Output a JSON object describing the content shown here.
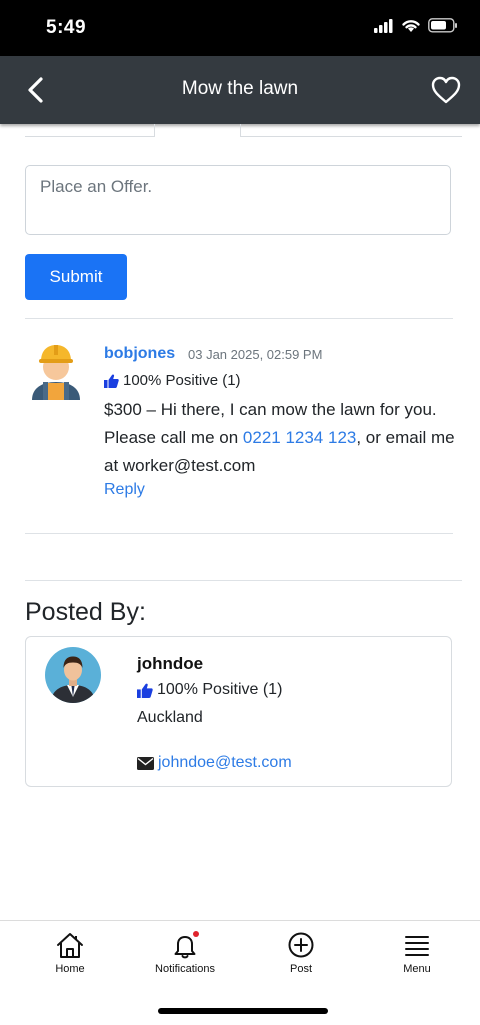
{
  "status": {
    "time": "5:49"
  },
  "header": {
    "title": "Mow the lawn"
  },
  "offer_form": {
    "placeholder": "Place an Offer.",
    "submit_label": "Submit"
  },
  "offer": {
    "username": "bobjones",
    "date": "03 Jan 2025, 02:59 PM",
    "rating": "100% Positive (1)",
    "message_start": "$300 – Hi there, I can mow the lawn for you. Please call me on ",
    "phone": "0221 1234 123",
    "message_end": ", or email me at worker@test.com",
    "reply_label": "Reply"
  },
  "posted_by": {
    "heading": "Posted By:",
    "username": "johndoe",
    "rating": "100% Positive (1)",
    "location": "Auckland",
    "email": "johndoe@test.com"
  },
  "tabs": [
    {
      "label": "Home",
      "icon": "home-icon"
    },
    {
      "label": "Notifications",
      "icon": "bell-icon"
    },
    {
      "label": "Post",
      "icon": "plus-circle-icon"
    },
    {
      "label": "Menu",
      "icon": "menu-icon"
    }
  ],
  "colors": {
    "accent": "#1a73f5",
    "link": "#2d7be5",
    "navbar": "#343a40",
    "thumb": "#1a3fe0",
    "badge": "#e0242d"
  }
}
